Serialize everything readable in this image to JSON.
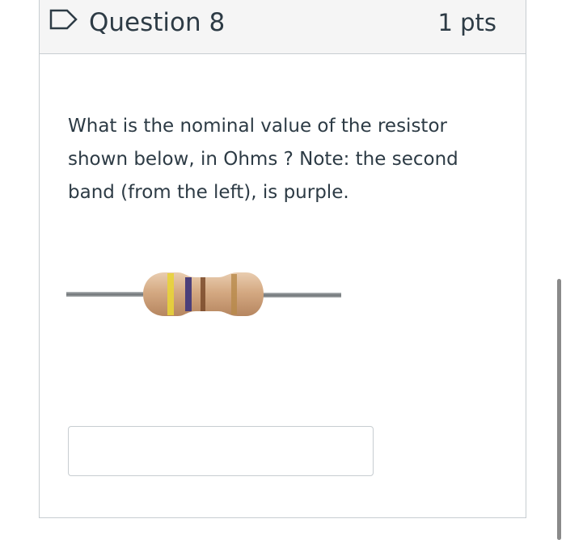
{
  "question": {
    "title": "Question 8",
    "points": "1 pts",
    "text": "What is the nominal value of the resistor shown below, in Ohms ? Note: the second band (from the left), is purple.",
    "answer_value": "",
    "answer_placeholder": ""
  },
  "resistor": {
    "bands": [
      {
        "name": "yellow-band",
        "color": "#e8d33a"
      },
      {
        "name": "purple-band",
        "color": "#4b3f7a"
      },
      {
        "name": "brown-band",
        "color": "#7a4a2a"
      },
      {
        "name": "gold-band",
        "color": "#b88a4a"
      }
    ],
    "body_color": "#d9b48f",
    "lead_color": "#8f9497"
  }
}
